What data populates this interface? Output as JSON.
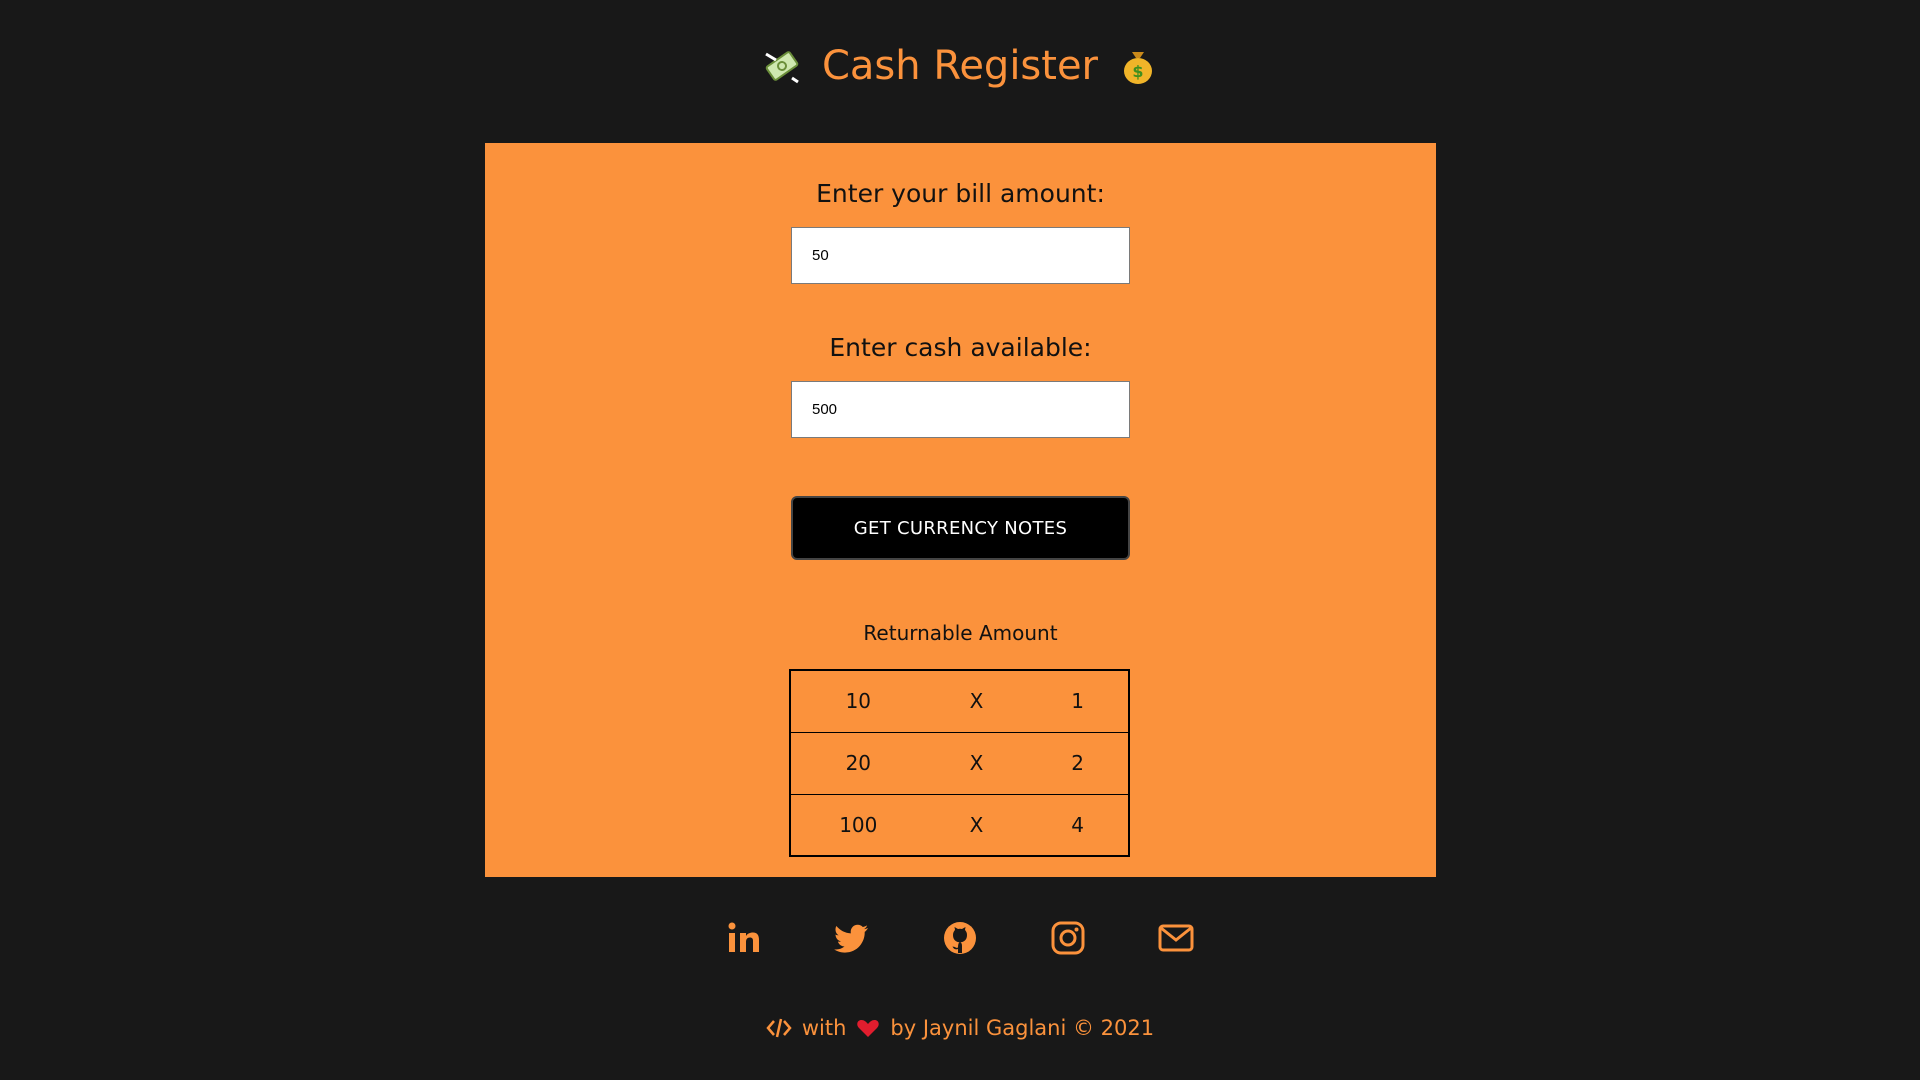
{
  "header": {
    "title": "Cash Register",
    "left_icon": "money-with-wings-icon",
    "right_icon": "money-bag-icon"
  },
  "form": {
    "bill_label": "Enter your bill amount:",
    "bill_value": "50",
    "cash_label": "Enter cash available:",
    "cash_value": "500",
    "button_label": "GET CURRENCY NOTES"
  },
  "result": {
    "title": "Returnable Amount",
    "rows": [
      {
        "note": "10",
        "sep": "X",
        "count": "1"
      },
      {
        "note": "20",
        "sep": "X",
        "count": "2"
      },
      {
        "note": "100",
        "sep": "X",
        "count": "4"
      }
    ]
  },
  "social": [
    "linkedin-icon",
    "twitter-icon",
    "github-icon",
    "instagram-icon",
    "mail-icon"
  ],
  "footer": {
    "code_icon": "code-icon",
    "with_text": "with",
    "heart_icon": "heart-icon",
    "by_text": "by Jaynil Gaglani © 2021"
  },
  "colors": {
    "accent": "#fb923c",
    "background": "#181818",
    "button": "#000000"
  }
}
